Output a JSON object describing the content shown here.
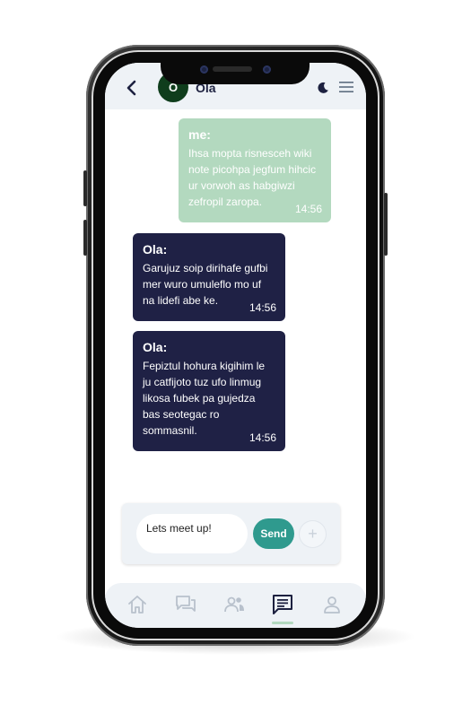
{
  "header": {
    "avatar_initial": "O",
    "contact_name": "Ola"
  },
  "messages": [
    {
      "sender": "me:",
      "text": "Ihsa mopta risnesceh wiki note picohpa jegfum hihcic ur vorwoh as habgiwzi zefropil zaropa.",
      "time": "14:56"
    },
    {
      "sender": "Ola:",
      "text": "Garujuz soip dirihafe gufbi mer wuro umuleflo mo uf na lidefi abe ke.",
      "time": "14:56"
    },
    {
      "sender": "Ola:",
      "text": "Fepiztul hohura kigihim le ju catfijoto tuz ufo linmug likosa fubek pa gujedza bas seotegac ro sommasnil.",
      "time": "14:56"
    }
  ],
  "composer": {
    "input_value": "Lets meet up!",
    "send_label": "Send",
    "add_symbol": "+"
  },
  "colors": {
    "my_bubble": "#b3d9bf",
    "their_bubble": "#1f2145",
    "send_button": "#2f9a8e",
    "header_bg": "#eef2f6",
    "avatar_bg": "#0f3d1c"
  },
  "nav": {
    "items": [
      "home-icon",
      "chats-icon",
      "friends-icon",
      "messages-icon",
      "profile-icon"
    ],
    "active": "messages-icon"
  }
}
